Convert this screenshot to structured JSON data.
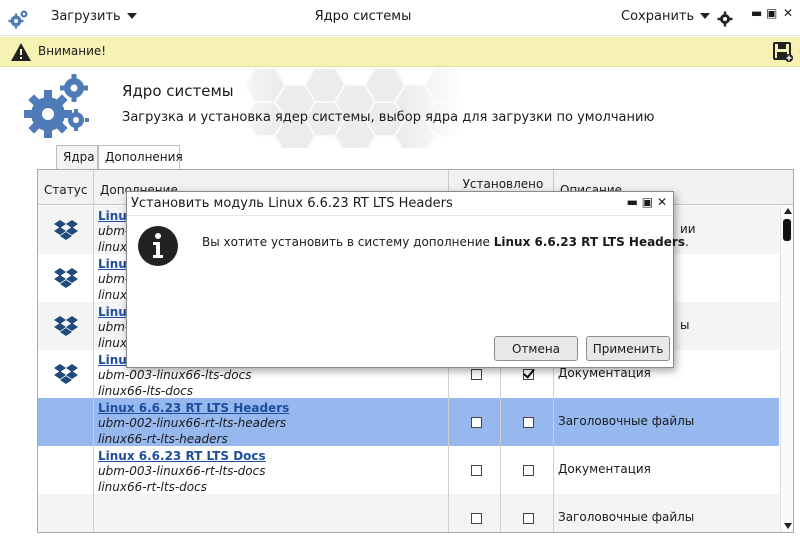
{
  "titlebar": {
    "load_label": "Загрузить",
    "title": "Ядро системы",
    "save_label": "Сохранить",
    "minimize": "▬",
    "maximize": "▣",
    "close": "✕"
  },
  "warning": {
    "text": "Внимание!"
  },
  "header": {
    "title": "Ядро системы",
    "subtitle": "Загрузка и установка ядер системы, выбор ядра для загрузки по умолчанию"
  },
  "tabs": [
    {
      "label": "Ядра",
      "active": false
    },
    {
      "label": "Дополнения",
      "active": true
    }
  ],
  "table": {
    "columns": {
      "status": "Статус",
      "addon": "Дополнение",
      "installed": "Установлено",
      "description": "Описание"
    },
    "rows": [
      {
        "name": "Linux",
        "line2": "ubm-",
        "line3": "linux",
        "installed": false,
        "checked": false,
        "description": "",
        "has_icon": true,
        "selected": false
      },
      {
        "name": "Linux",
        "line2": "ubm-",
        "line3": "linux",
        "installed": false,
        "checked": false,
        "description": "",
        "has_icon": true,
        "selected": false
      },
      {
        "name": "Linux",
        "line2": "ubm-",
        "line3": "linux",
        "installed": false,
        "checked": false,
        "description": "",
        "has_icon": true,
        "selected": false
      },
      {
        "name": "Linux",
        "line2": "ubm-003-linux66-lts-docs",
        "line3": "linux66-lts-docs",
        "installed": false,
        "checked": true,
        "description": "Документация",
        "has_icon": true,
        "selected": false
      },
      {
        "name": "Linux 6.6.23 RT LTS Headers",
        "line2": "ubm-002-linux66-rt-lts-headers",
        "line3": "linux66-rt-lts-headers",
        "installed": false,
        "checked": false,
        "description": "Заголовочные файлы",
        "has_icon": false,
        "selected": true
      },
      {
        "name": "Linux 6.6.23 RT LTS Docs",
        "line2": "ubm-003-linux66-rt-lts-docs",
        "line3": "linux66-rt-lts-docs",
        "installed": false,
        "checked": false,
        "description": "Документация",
        "has_icon": false,
        "selected": false
      },
      {
        "name": "",
        "line2": "",
        "line3": "",
        "installed": false,
        "checked": false,
        "description": "Заголовочные файлы",
        "has_icon": false,
        "selected": false
      }
    ],
    "partial_desc_row1": "ии",
    "partial_desc_row3": "ы"
  },
  "dialog": {
    "title": "Установить модуль Linux 6.6.23 RT LTS Headers",
    "message_prefix": "Вы хотите установить в систему дополнение ",
    "message_bold": "Linux 6.6.23 RT LTS Headers",
    "message_suffix": ".",
    "cancel_label": "Отмена",
    "apply_label": "Применить",
    "controls": "▬ ▣ ✕"
  },
  "colors": {
    "accent_blue": "#4f7cb8",
    "selection": "#96b8ef",
    "warning_bg": "#f6f2b4",
    "link": "#1e4d9c"
  }
}
